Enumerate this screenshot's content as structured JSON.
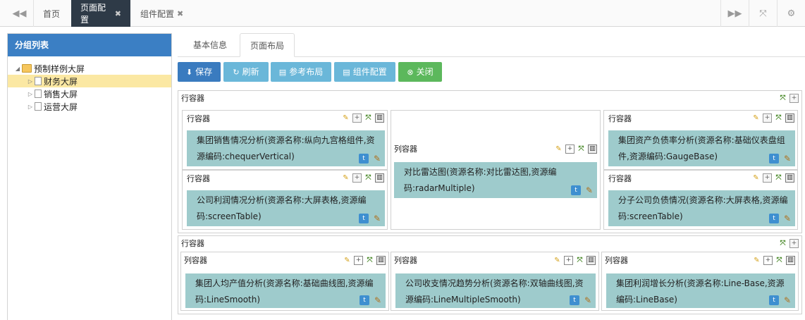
{
  "topbar": {
    "prev_icon": "double-chevron-left",
    "tabs": [
      {
        "label": "首页"
      },
      {
        "label": "页面配置",
        "close": "✖"
      },
      {
        "label": "组件配置",
        "close": "✖"
      }
    ],
    "right_icons": [
      "double-chevron-right",
      "expand-arrows",
      "gear"
    ]
  },
  "left_panel": {
    "title": "分组列表",
    "tree": {
      "root": "预制样例大屏",
      "children": [
        "财务大屏",
        "销售大屏",
        "运营大屏"
      ],
      "selected": "财务大屏"
    }
  },
  "main_tabs": [
    "基本信息",
    "页面布局"
  ],
  "toolbar": {
    "save": "保存",
    "refresh": "刷新",
    "ref_layout": "参考布局",
    "comp_config": "组件配置",
    "close": "关闭"
  },
  "layout": {
    "row1": {
      "label": "行容器",
      "left": [
        {
          "label": "行容器",
          "component": "集团销售情况分析(资源名称:纵向九宫格组件,资源编码:chequerVertical)"
        },
        {
          "label": "行容器",
          "component": "公司利润情况分析(资源名称:大屏表格,资源编码:screenTable)"
        }
      ],
      "middle": {
        "label": "列容器",
        "component": "对比雷达图(资源名称:对比雷达图,资源编码:radarMultiple)"
      },
      "right": [
        {
          "label": "行容器",
          "component": "集团资产负债率分析(资源名称:基础仪表盘组件,资源编码:GaugeBase)"
        },
        {
          "label": "行容器",
          "component": "分子公司负债情况(资源名称:大屏表格,资源编码:screenTable)"
        }
      ]
    },
    "row2": {
      "label": "行容器",
      "cols": [
        {
          "label": "列容器",
          "component": "集团人均产值分析(资源名称:基础曲线图,资源编码:LineSmooth)"
        },
        {
          "label": "列容器",
          "component": "公司收支情况趋势分析(资源名称:双轴曲线图,资源编码:LineMultipleSmooth)"
        },
        {
          "label": "列容器",
          "component": "集团利润增长分析(资源名称:Line-Base,资源编码:LineBase)"
        }
      ]
    }
  },
  "colors": {
    "active_tab": "#2e3a47",
    "panel_header": "#3b7fc4",
    "save_button": "#3a7bbf",
    "light_button": "#6ab7d9",
    "close_button": "#5cb85c",
    "component_bg": "#9ecbcc",
    "tree_selected": "#fbe8a3"
  }
}
